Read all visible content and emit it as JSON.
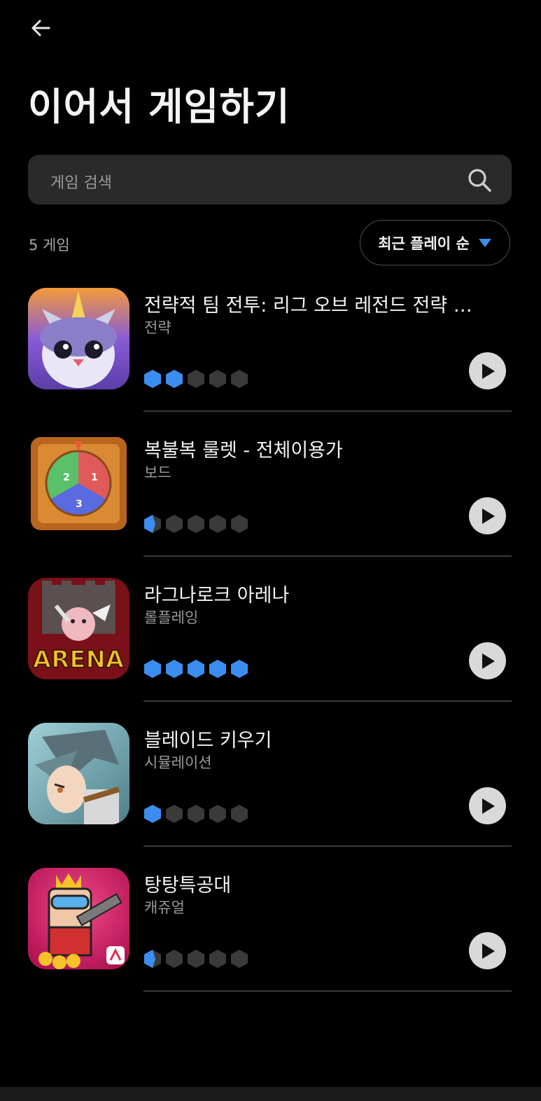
{
  "header": {
    "title": "이어서 게임하기"
  },
  "search": {
    "placeholder": "게임 검색"
  },
  "list_header": {
    "count_text": "5 게임",
    "sort_label": "최근 플레이 순"
  },
  "colors": {
    "accent": "#3b8ef0",
    "hex_empty": "#3a3a3a",
    "play_bg": "#d9d9d9"
  },
  "games": [
    {
      "name": "전략적 팀 전투: 리그 오브 레전드 전략 …",
      "genre": "전략",
      "level": 2,
      "icon": "tft-penguin-icon"
    },
    {
      "name": "복불복 룰렛 - 전체이용가",
      "genre": "보드",
      "level": 0.5,
      "icon": "roulette-wheel-icon"
    },
    {
      "name": "라그나로크 아레나",
      "genre": "롤플레잉",
      "level": 5,
      "icon": "ragnarok-arena-icon"
    },
    {
      "name": "블레이드 키우기",
      "genre": "시뮬레이션",
      "level": 1,
      "icon": "blade-warrior-icon"
    },
    {
      "name": "탕탕특공대",
      "genre": "캐쥬얼",
      "level": 0.5,
      "icon": "tangtang-soldier-icon"
    }
  ],
  "roulette_numbers": [
    "2",
    "1",
    "3"
  ],
  "arena_logo_text": "ARENA"
}
